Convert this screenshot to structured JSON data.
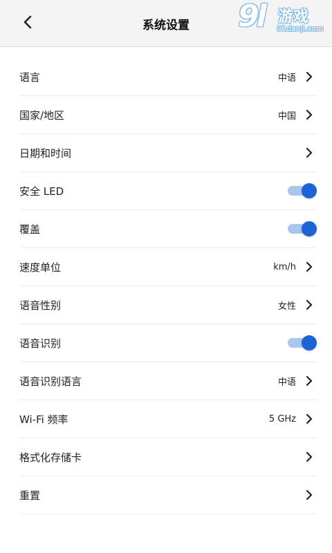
{
  "header": {
    "title": "系统设置",
    "back_icon": "chevron-left-icon"
  },
  "watermark": {
    "number": "9l",
    "name": "游戏",
    "url": "91danji.com"
  },
  "colors": {
    "toggle_on_knob": "#1c64d6",
    "toggle_on_track": "#a9c6ee",
    "header_bg": "#f4f4f4"
  },
  "settings": [
    {
      "label": "语言",
      "value": "中语",
      "kind": "chevron"
    },
    {
      "label": "国家/地区",
      "value": "中国",
      "kind": "chevron"
    },
    {
      "label": "日期和时间",
      "value": "",
      "kind": "chevron"
    },
    {
      "label": "安全 LED",
      "kind": "toggle",
      "on": true
    },
    {
      "label": "覆盖",
      "kind": "toggle",
      "on": true
    },
    {
      "label": "速度单位",
      "value": "km/h",
      "kind": "chevron"
    },
    {
      "label": "语音性别",
      "value": "女性",
      "kind": "chevron"
    },
    {
      "label": "语音识别",
      "kind": "toggle",
      "on": true
    },
    {
      "label": "语音识别语言",
      "value": "中语",
      "kind": "chevron"
    },
    {
      "label": "Wi-Fi 频率",
      "value": "5 GHz",
      "kind": "chevron"
    },
    {
      "label": "格式化存储卡",
      "value": "",
      "kind": "chevron"
    },
    {
      "label": "重置",
      "value": "",
      "kind": "chevron"
    }
  ]
}
